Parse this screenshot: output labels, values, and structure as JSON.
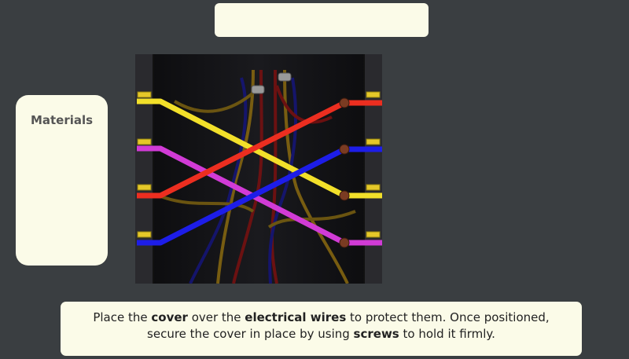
{
  "materials": {
    "title": "Materials"
  },
  "instruction": {
    "t1": "Place the ",
    "b1": "cover",
    "t2": " over the ",
    "b2": "electrical wires",
    "t3": " to protect them. Once positioned, secure the cover in place by using ",
    "b3": "screws",
    "t4": " to hold it firmly."
  },
  "wires": [
    {
      "name": "yellow",
      "color": "#f2e02a"
    },
    {
      "name": "magenta",
      "color": "#d13bd6"
    },
    {
      "name": "red",
      "color": "#ec2e20"
    },
    {
      "name": "blue",
      "color": "#1d1de8"
    }
  ]
}
